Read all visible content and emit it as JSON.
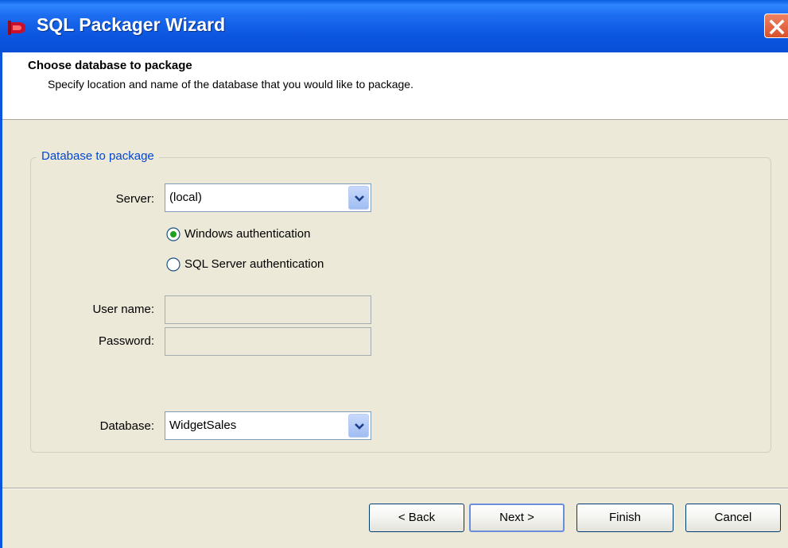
{
  "window": {
    "title": "SQL Packager Wizard"
  },
  "header": {
    "title": "Choose database to package",
    "subtitle": "Specify location and name of the database that you would like to package."
  },
  "group": {
    "legend": "Database to package",
    "server_label": "Server:",
    "server_value": "(local)",
    "auth_windows": "Windows authentication",
    "auth_sql": "SQL Server authentication",
    "selected_auth": "windows",
    "username_label": "User name:",
    "username_value": "",
    "password_label": "Password:",
    "password_value": "",
    "database_label": "Database:",
    "database_value": "WidgetSales"
  },
  "buttons": {
    "back": "< Back",
    "next": "Next >",
    "finish": "Finish",
    "cancel": "Cancel"
  },
  "colors": {
    "titlebar": "#0a55df",
    "dialog_bg": "#ece9d8",
    "group_legend": "#0046d5",
    "close_button": "#d9512b"
  }
}
